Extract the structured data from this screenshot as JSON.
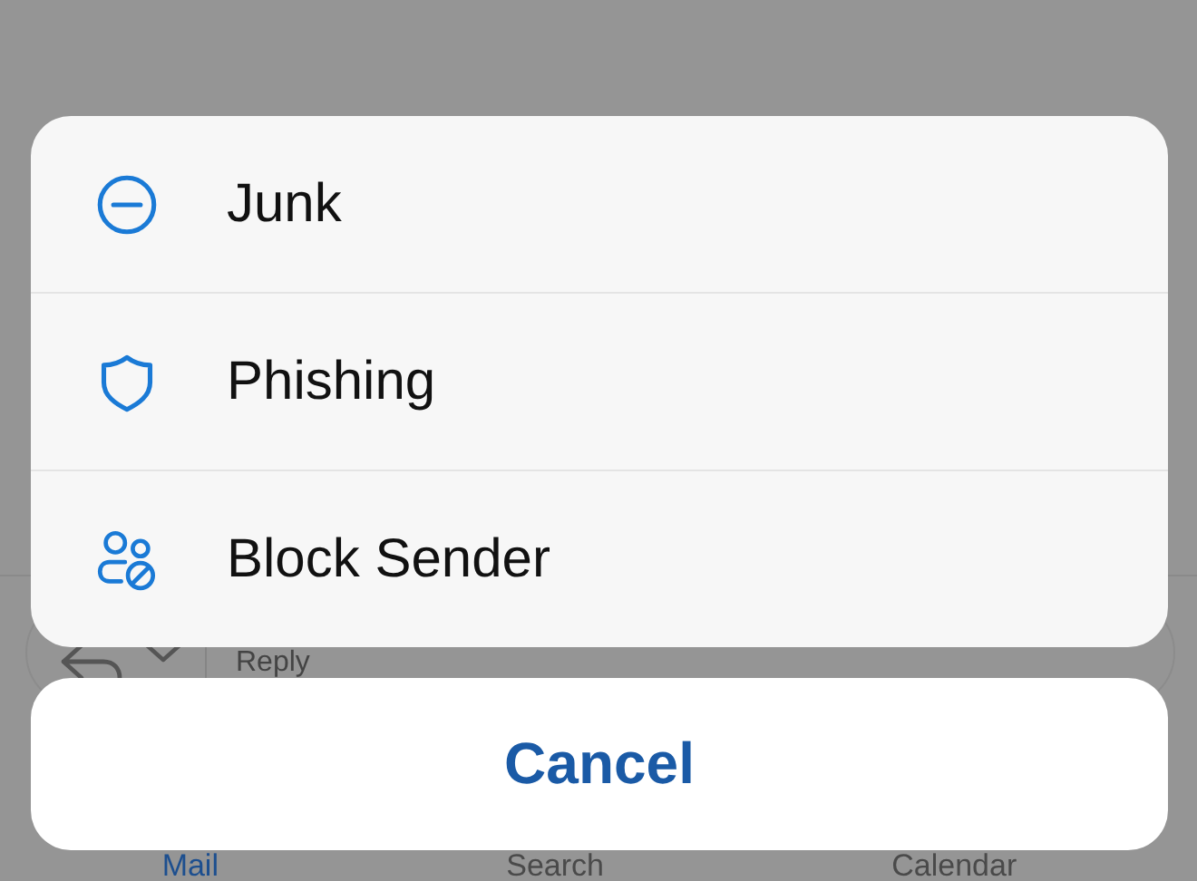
{
  "background": {
    "reply_field": {
      "placeholder": "Reply"
    },
    "tabs": [
      {
        "label": "Mail",
        "selected": true
      },
      {
        "label": "Search",
        "selected": false
      },
      {
        "label": "Calendar",
        "selected": false
      }
    ]
  },
  "action_sheet": {
    "items": [
      {
        "label": "Junk",
        "kind": "junk"
      },
      {
        "label": "Phishing",
        "kind": "phishing"
      },
      {
        "label": "Block Sender",
        "kind": "block"
      }
    ],
    "cancel": "Cancel"
  }
}
